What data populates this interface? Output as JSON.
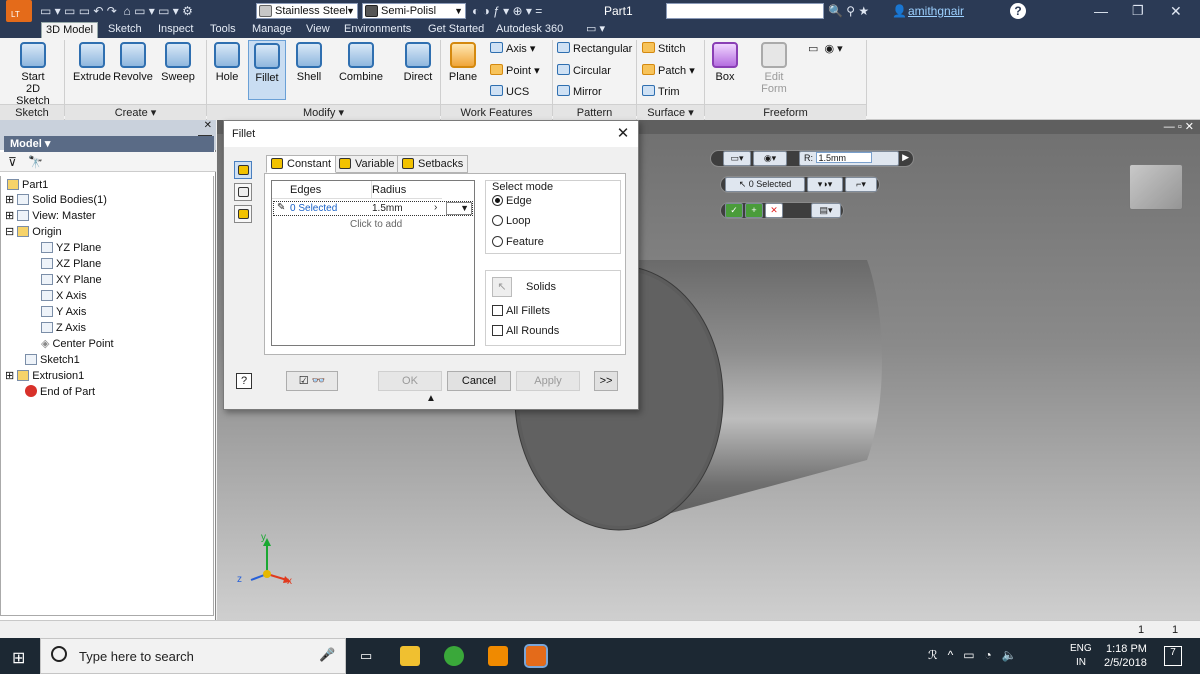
{
  "title_bar": {
    "material": "Stainless Steel",
    "appearance": "Semi-Polisl",
    "document": "Part1",
    "user": "amithgnair",
    "help": "?",
    "app_badge": "LT"
  },
  "ribbon_tabs": [
    "3D Model",
    "Sketch",
    "Inspect",
    "Tools",
    "Manage",
    "View",
    "Environments",
    "Get Started",
    "Autodesk 360"
  ],
  "ribbon": {
    "start_sketch": "Start\n2D Sketch",
    "create": [
      "Extrude",
      "Revolve",
      "Sweep"
    ],
    "modify": [
      "Hole",
      "Fillet",
      "Shell",
      "Combine",
      "Direct"
    ],
    "plane": "Plane",
    "work_features": [
      "Axis",
      "Point",
      "UCS"
    ],
    "pattern": [
      "Rectangular",
      "Circular",
      "Mirror"
    ],
    "surface": [
      "Stitch",
      "Patch",
      "Trim"
    ],
    "box": "Box",
    "edit_form": "Edit\nForm",
    "groups": [
      "Sketch",
      "Create ▾",
      "Modify ▾",
      "Work Features",
      "Pattern",
      "Surface ▾",
      "Freeform"
    ]
  },
  "browser": {
    "title": "Model ▾",
    "items": [
      "Part1",
      "Solid Bodies(1)",
      "View: Master",
      "Origin",
      "YZ Plane",
      "XZ Plane",
      "XY Plane",
      "X Axis",
      "Y Axis",
      "Z Axis",
      "Center Point",
      "Sketch1",
      "Extrusion1",
      "End of Part"
    ]
  },
  "dialog": {
    "title": "Fillet",
    "close": "✕",
    "tabs": [
      "Constant",
      "Variable",
      "Setbacks"
    ],
    "col_edges": "Edges",
    "col_radius": "Radius",
    "row_edges": "0 Selected",
    "row_radius": "1.5mm",
    "click_to_add": "Click to add",
    "select_mode_label": "Select mode",
    "modes": [
      "Edge",
      "Loop",
      "Feature"
    ],
    "solids": "Solids",
    "all_fillets": "All Fillets",
    "all_rounds": "All Rounds",
    "ok": "OK",
    "cancel": "Cancel",
    "apply": "Apply",
    "more": ">>"
  },
  "mini_toolbar": {
    "radius_label": "R:",
    "radius_value": "1.5mm",
    "selected": "0 Selected"
  },
  "triad": {
    "y": "y",
    "z": "z",
    "x": "x"
  },
  "status_bar": {
    "count_a": "1",
    "count_b": "1"
  },
  "taskbar": {
    "search_placeholder": "Type here to search",
    "lang": "ENG",
    "region": "IN",
    "time": "1:18 PM",
    "date": "2/5/2018",
    "notifications": "7"
  }
}
